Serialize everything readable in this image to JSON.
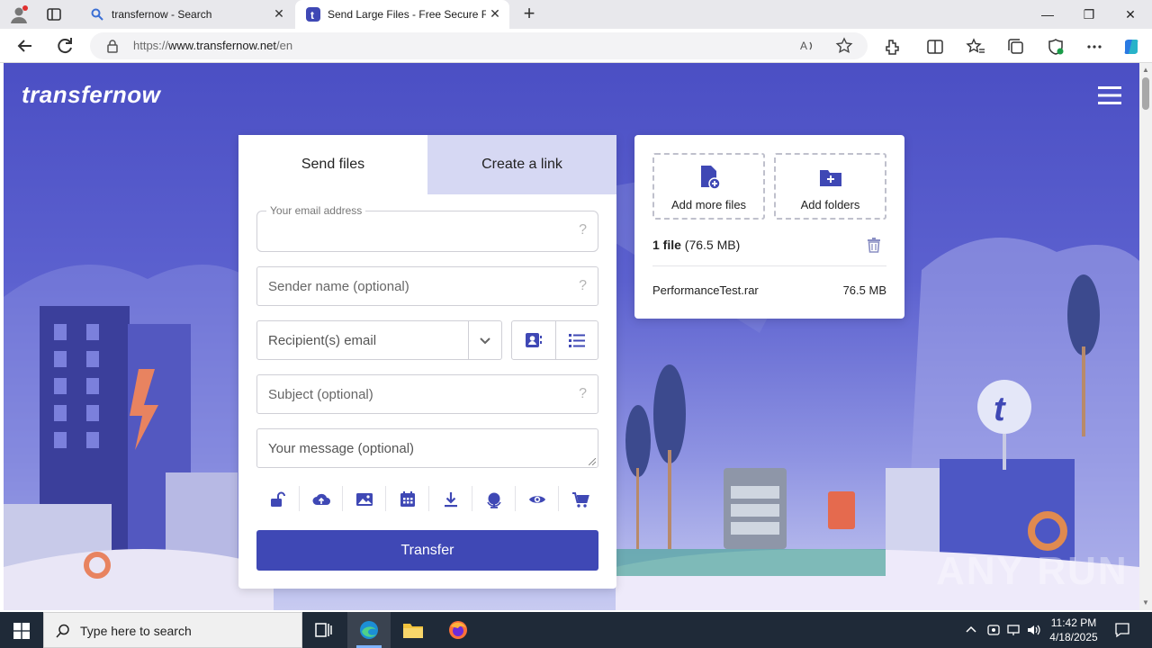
{
  "browser": {
    "tabs": [
      {
        "title": "transfernow - Search",
        "close": "✕"
      },
      {
        "title": "Send Large Files - Free Secure File Transfer",
        "close": "✕"
      }
    ],
    "new_tab": "+",
    "window_controls": {
      "minimize": "—",
      "restore": "❐",
      "close": "✕"
    },
    "address": {
      "prefix": "https://",
      "host": "www.transfernow.net",
      "path": "/en"
    }
  },
  "page": {
    "logo": "transfernow",
    "form": {
      "tab_send": "Send files",
      "tab_link": "Create a link",
      "email_label": "Your email address",
      "sender_placeholder": "Sender name (optional)",
      "recipient_placeholder": "Recipient(s) email",
      "subject_placeholder": "Subject (optional)",
      "message_placeholder": "Your message (optional)",
      "help": "?",
      "options": [
        "lock-icon",
        "cloud-icon",
        "image-icon",
        "calendar-icon",
        "download-icon",
        "globe-icon",
        "eye-icon",
        "cart-icon"
      ],
      "transfer_button": "Transfer"
    },
    "files": {
      "add_files": "Add more files",
      "add_folders": "Add folders",
      "count_label": "1 file",
      "total_size": "(76.5 MB)",
      "items": [
        {
          "name": "PerformanceTest.rar",
          "size": "76.5 MB"
        }
      ]
    },
    "watermark": "ANY RUN"
  },
  "taskbar": {
    "search_placeholder": "Type here to search",
    "time": "11:42 PM",
    "date": "4/18/2025"
  },
  "colors": {
    "brand": "#4b4fc4",
    "button": "#3f48b5",
    "inactive_tab": "#d6d8f3"
  }
}
